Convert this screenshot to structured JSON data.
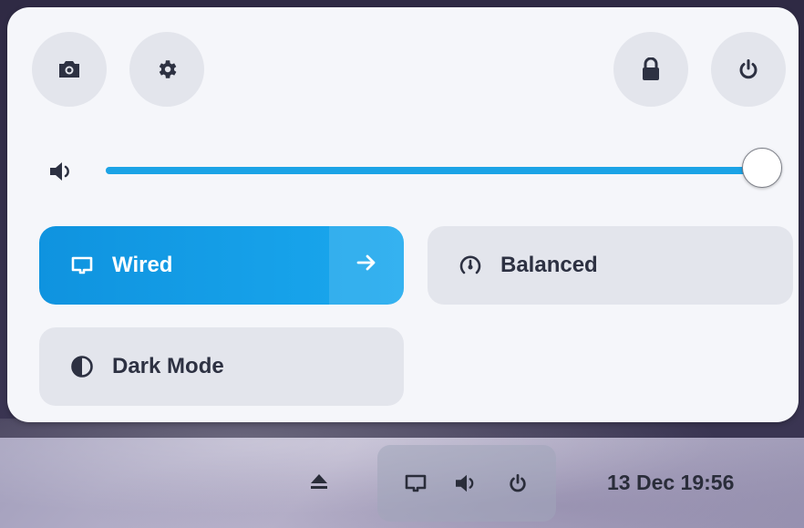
{
  "colors": {
    "accent": "#1ba3e6",
    "panel_bg": "#f5f6fa",
    "button_bg": "#e3e5ec",
    "text": "#2d3142"
  },
  "quick_settings": {
    "buttons_left": [
      {
        "icon": "screenshot-icon"
      },
      {
        "icon": "gear-icon"
      }
    ],
    "buttons_right": [
      {
        "icon": "lock-icon"
      },
      {
        "icon": "power-icon"
      }
    ],
    "volume": {
      "icon": "speaker-icon",
      "level": 1.0
    },
    "tiles": {
      "wired": {
        "label": "Wired",
        "icon": "network-wired-icon",
        "active": true,
        "has_menu": true
      },
      "power_mode": {
        "label": "Balanced",
        "icon": "speedometer-icon",
        "active": false
      },
      "dark_mode": {
        "label": "Dark Mode",
        "icon": "dark-mode-icon",
        "active": false
      }
    }
  },
  "taskbar": {
    "eject_icon": "eject-icon",
    "status_icons": [
      "network-wired-icon",
      "speaker-icon",
      "power-icon"
    ],
    "clock": "13 Dec  19:56"
  }
}
